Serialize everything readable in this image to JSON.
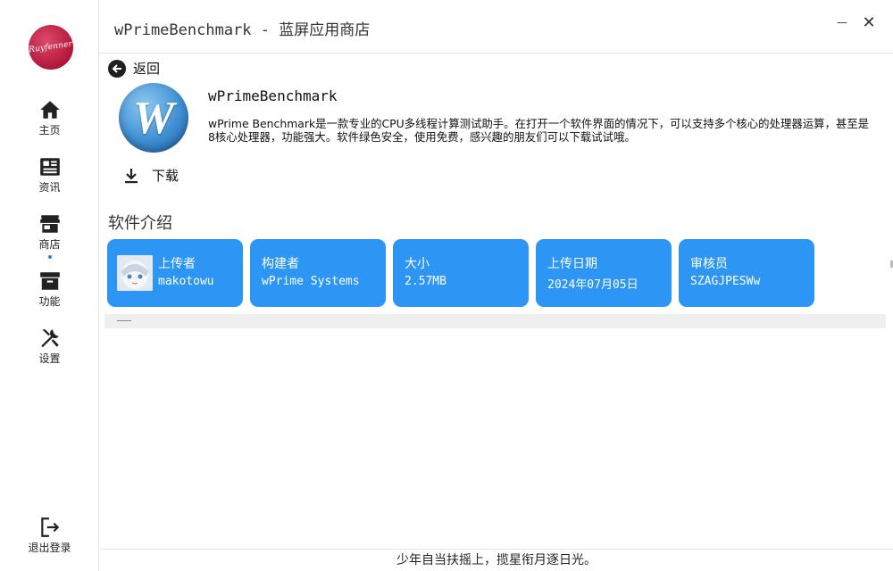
{
  "window": {
    "title": "wPrimeBenchmark - 蓝屏应用商店",
    "minimize_symbol": "—",
    "close_symbol": "✕"
  },
  "sidebar": {
    "logo_text": "Ruyfenner",
    "items": [
      {
        "label": "主页",
        "icon": "home-icon"
      },
      {
        "label": "资讯",
        "icon": "news-icon"
      },
      {
        "label": "商店",
        "icon": "store-icon",
        "active": true
      },
      {
        "label": "功能",
        "icon": "function-icon"
      },
      {
        "label": "设置",
        "icon": "settings-icon"
      }
    ],
    "logout": {
      "label": "退出登录",
      "icon": "logout-icon"
    }
  },
  "main": {
    "back_label": "返回",
    "app": {
      "icon_letter": "W",
      "name": "wPrimeBenchmark",
      "description": "wPrime Benchmark是一款专业的CPU多线程计算测试助手。在打开一个软件界面的情况下，可以支持多个核心的处理器运算，甚至是8核心处理器，功能强大。软件绿色安全，使用免费，感兴趣的朋友们可以下载试试哦。"
    },
    "download_label": "下载",
    "section_title": "软件介绍",
    "info_cards": [
      {
        "title": "上传者",
        "value": "makotowu",
        "has_avatar": true
      },
      {
        "title": "构建者",
        "value": "wPrime Systems"
      },
      {
        "title": "大小",
        "value": "2.57MB"
      },
      {
        "title": "上传日期",
        "value": "2024年07月05日"
      },
      {
        "title": "审核员",
        "value": "SZAGJPESWw"
      }
    ]
  },
  "footer": {
    "motto": "少年自当扶摇上，揽星衔月逐日光。"
  },
  "colors": {
    "card_blue": "#2d96f4",
    "logo_red": "#c8234a",
    "active_dot": "#2e7bd6"
  }
}
